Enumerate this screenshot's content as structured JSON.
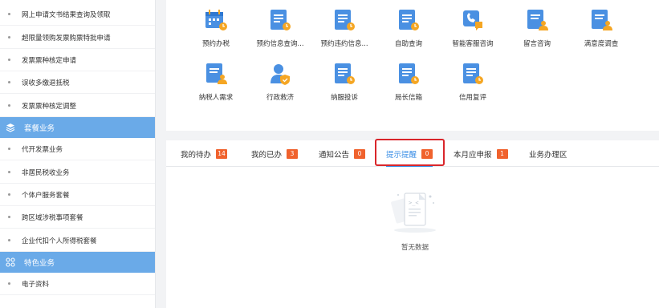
{
  "sidebar": {
    "items_top": [
      {
        "label": "网上申请文书结果查询及领取"
      },
      {
        "label": "超限量领购发票购票特批申请"
      },
      {
        "label": "发票票种核定申请"
      },
      {
        "label": "误收多缴退抵税"
      },
      {
        "label": "发票票种核定调整"
      }
    ],
    "group1": {
      "label": "套餐业务"
    },
    "items_mid": [
      {
        "label": "代开发票业务"
      },
      {
        "label": "非居民税收业务"
      },
      {
        "label": "个体户服务套餐"
      },
      {
        "label": "跨区域涉税事项套餐"
      },
      {
        "label": "企业代扣个人所得税套餐"
      }
    ],
    "group2": {
      "label": "特色业务"
    },
    "items_bottom": [
      {
        "label": "电子资料"
      }
    ]
  },
  "services": [
    {
      "label": "预约办税",
      "icon": "calendar-icon"
    },
    {
      "label": "预约信息查询...",
      "icon": "document-clock-icon"
    },
    {
      "label": "预约违约信息...",
      "icon": "document-clock-icon"
    },
    {
      "label": "自助查询",
      "icon": "document-clock-icon"
    },
    {
      "label": "智能客服咨询",
      "icon": "phone-chat-icon"
    },
    {
      "label": "留言咨询",
      "icon": "user-document-icon"
    },
    {
      "label": "满意度调查",
      "icon": "user-document-icon"
    },
    {
      "label": "纳税人需求",
      "icon": "user-document-icon"
    },
    {
      "label": "行政救济",
      "icon": "user-shield-icon"
    },
    {
      "label": "纳服投诉",
      "icon": "document-clock-icon"
    },
    {
      "label": "局长信箱",
      "icon": "document-clock-icon"
    },
    {
      "label": "信用复评",
      "icon": "document-clock-icon"
    }
  ],
  "tabs": [
    {
      "label": "我的待办",
      "badge": "14"
    },
    {
      "label": "我的已办",
      "badge": "3"
    },
    {
      "label": "通知公告",
      "badge": "0"
    },
    {
      "label": "提示提醒",
      "badge": "0"
    },
    {
      "label": "本月应申报",
      "badge": "1"
    },
    {
      "label": "业务办理区",
      "badge": ""
    }
  ],
  "empty": {
    "text": "暂无数据",
    "icon": "empty-document-icon"
  },
  "colors": {
    "accent": "#3a8ee6",
    "sidebar_group": "#6aaae8",
    "badge": "#f0622d",
    "highlight": "#d9262b",
    "icon_blue": "#4a90e2",
    "icon_orange": "#f5a623"
  }
}
